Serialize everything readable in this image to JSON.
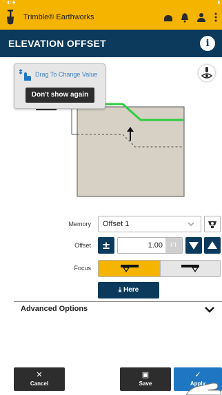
{
  "app": {
    "title": "Trimble® Earthworks"
  },
  "header": {
    "title": "ELEVATION OFFSET",
    "info_icon": "i"
  },
  "tooltip": {
    "text": "Drag To Change Value",
    "button": "Don't show again"
  },
  "form": {
    "memory_label": "Memory",
    "memory_value": "Offset 1",
    "offset_label": "Offset",
    "offset_value": "1.00",
    "offset_unit": "FT",
    "plus_minus": "±",
    "focus_label": "Focus",
    "here_label": "Here",
    "advanced_label": "Advanced Options"
  },
  "actions": {
    "cancel": "Cancel",
    "save": "Save",
    "apply": "Apply"
  },
  "colors": {
    "accent": "#f5b400",
    "header": "#0b3a5c",
    "apply": "#1f77c4",
    "design_line": "#2ecc40",
    "terrain": "#d6d1c4"
  }
}
